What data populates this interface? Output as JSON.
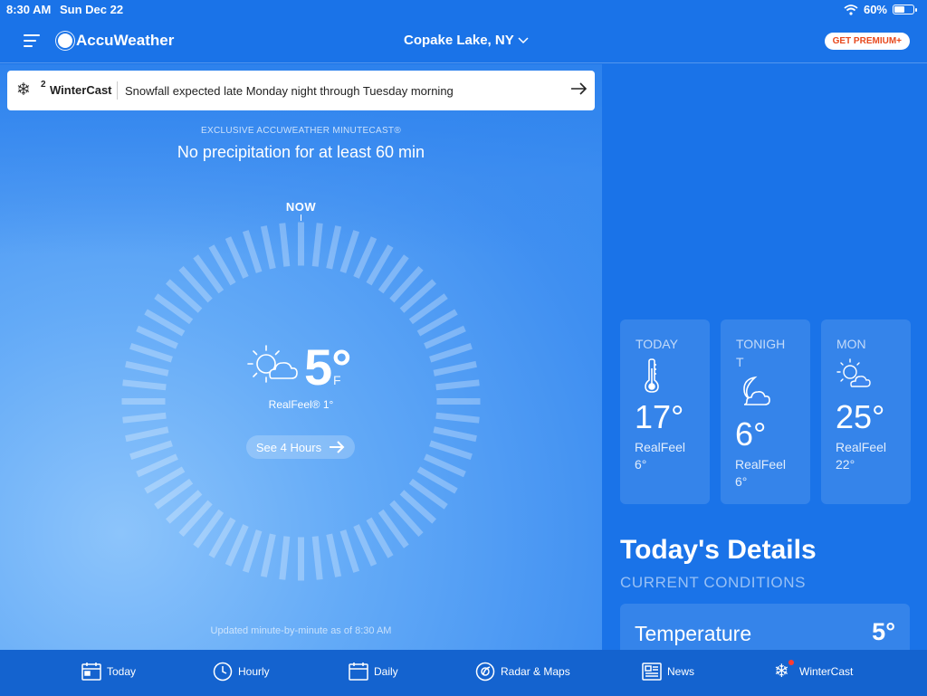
{
  "status_bar": {
    "time": "8:30 AM",
    "date": "Sun Dec 22",
    "battery": "60%",
    "battery_level": 0.6
  },
  "header": {
    "app_name": "AccuWeather",
    "location": "Copake Lake, NY",
    "premium_label": "GET PREMIUM+"
  },
  "wintercast_banner": {
    "count": "2",
    "title": "WinterCast",
    "message": "Snowfall expected late Monday night through Tuesday morning"
  },
  "minutecast": {
    "label": "EXCLUSIVE ACCUWEATHER MINUTECAST®",
    "summary": "No precipitation for at least 60 min",
    "now_label": "NOW",
    "updated": "Updated minute-by-minute as of 8:30 AM"
  },
  "current": {
    "temp": "5°",
    "unit": "F",
    "realfeel": "RealFeel® 1°",
    "see_hours": "See 4 Hours",
    "icon": "partly-sunny-icon"
  },
  "forecast_cards": [
    {
      "label": "TODAY",
      "temp": "17°",
      "realfeel_label": "RealFeel",
      "realfeel_value": "6°",
      "icon": "thermometer-icon"
    },
    {
      "label": "TONIGHT",
      "temp": "6°",
      "realfeel_label": "RealFeel",
      "realfeel_value": "6°",
      "icon": "moon-cloud-icon"
    },
    {
      "label": "MON",
      "temp": "25°",
      "realfeel_label": "RealFeel",
      "realfeel_value": "22°",
      "icon": "partly-sunny-icon"
    }
  ],
  "details": {
    "title": "Today's Details",
    "subtitle": "CURRENT CONDITIONS",
    "rows": [
      {
        "name": "Temperature",
        "value": "5°"
      }
    ]
  },
  "tabs": [
    {
      "label": "Today",
      "icon": "calendar-today-icon"
    },
    {
      "label": "Hourly",
      "icon": "clock-icon"
    },
    {
      "label": "Daily",
      "icon": "calendar-icon"
    },
    {
      "label": "Radar & Maps",
      "icon": "radar-icon"
    },
    {
      "label": "News",
      "icon": "news-icon"
    },
    {
      "label": "WinterCast",
      "icon": "snowflake-icon"
    }
  ],
  "colors": {
    "background": "#1a73e8",
    "tab_bar": "#1463cf",
    "premium_text": "#e8491d"
  }
}
